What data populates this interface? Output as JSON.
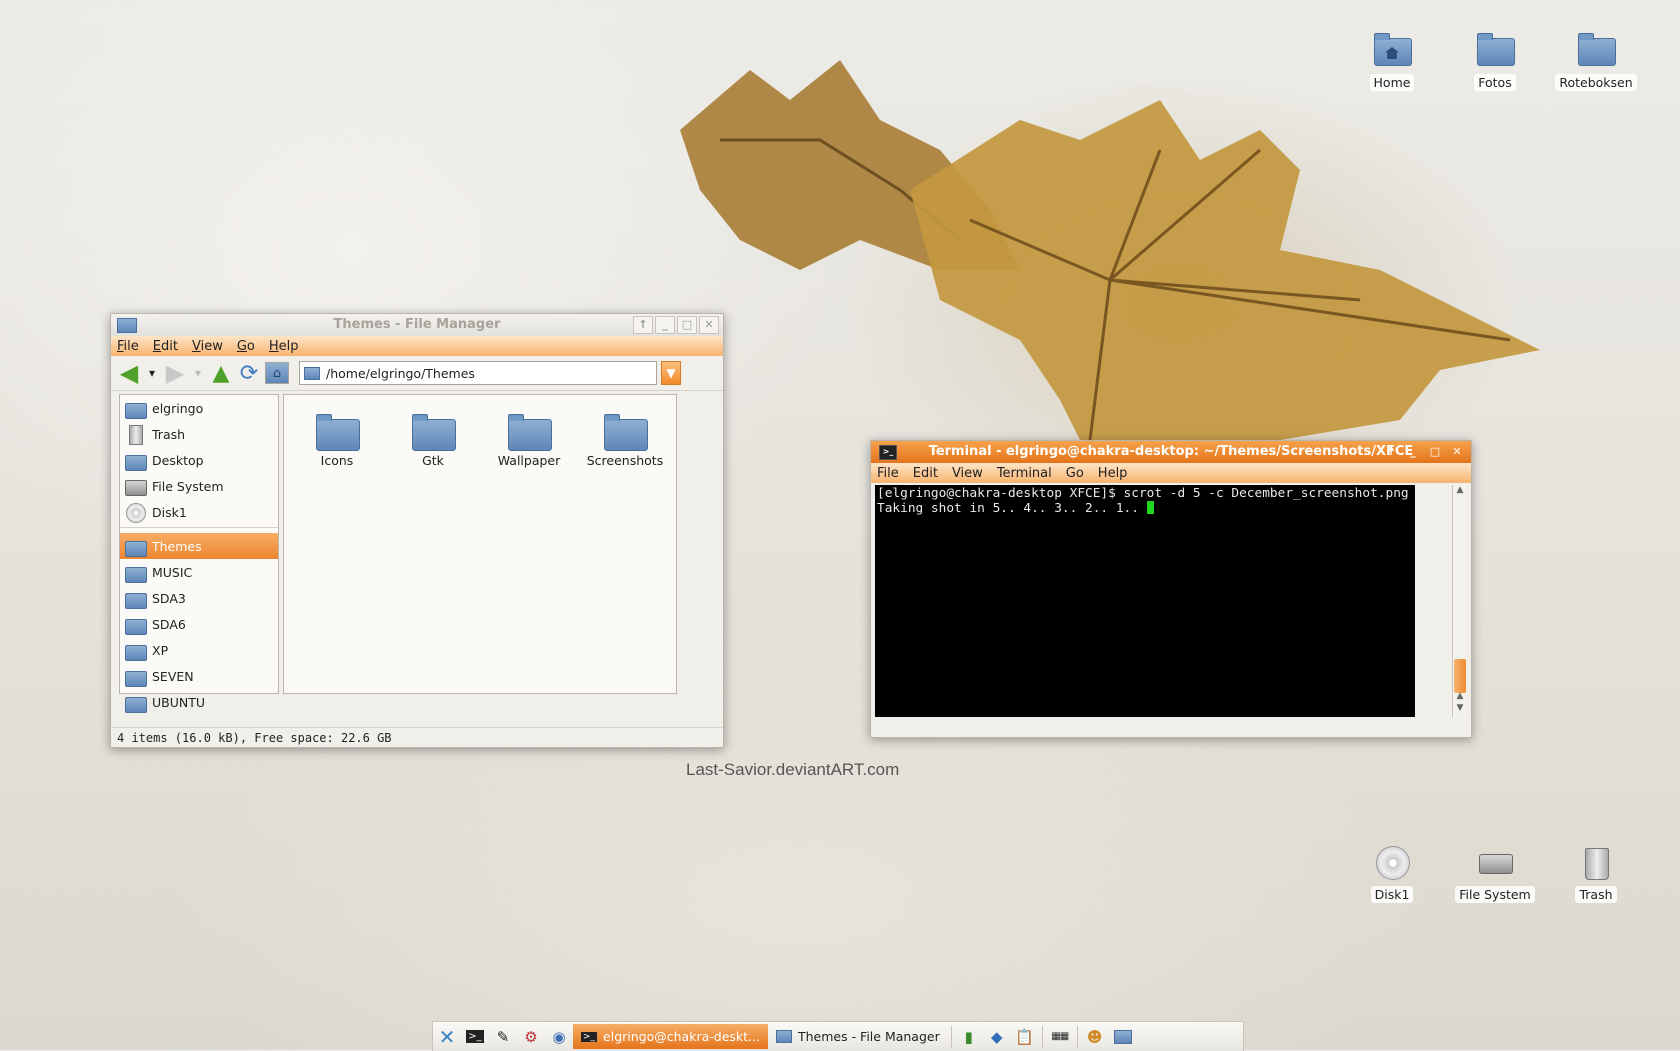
{
  "desktop": {
    "top_icons": [
      {
        "label": "Home",
        "icon": "home-folder-icon"
      },
      {
        "label": "Fotos",
        "icon": "folder-icon"
      },
      {
        "label": "Roteboksen",
        "icon": "folder-icon"
      }
    ],
    "bottom_icons": [
      {
        "label": "Disk1",
        "icon": "disc-icon"
      },
      {
        "label": "File System",
        "icon": "harddisk-icon"
      },
      {
        "label": "Trash",
        "icon": "trash-icon"
      }
    ],
    "watermark": "Last-Savior.deviantART.com"
  },
  "file_manager": {
    "title": "Themes - File Manager",
    "menu": [
      "File",
      "Edit",
      "View",
      "Go",
      "Help"
    ],
    "path": "/home/elgringo/Themes",
    "places": [
      {
        "label": "elgringo",
        "icon": "home-icon"
      },
      {
        "label": "Trash",
        "icon": "trash-icon"
      },
      {
        "label": "Desktop",
        "icon": "desktop-icon"
      },
      {
        "label": "File System",
        "icon": "harddisk-icon"
      },
      {
        "label": "Disk1",
        "icon": "disc-icon"
      }
    ],
    "bookmarks": [
      {
        "label": "Themes",
        "selected": true
      },
      {
        "label": "MUSIC"
      },
      {
        "label": "SDA3"
      },
      {
        "label": "SDA6"
      },
      {
        "label": "XP"
      },
      {
        "label": "SEVEN"
      },
      {
        "label": "UBUNTU"
      }
    ],
    "items": [
      "Icons",
      "Gtk",
      "Wallpaper",
      "Screenshots"
    ],
    "status": "4 items (16.0 kB), Free space: 22.6 GB"
  },
  "terminal": {
    "title": "Terminal - elgringo@chakra-desktop: ~/Themes/Screenshots/XFCE",
    "menu": [
      "File",
      "Edit",
      "View",
      "Terminal",
      "Go",
      "Help"
    ],
    "line1": "[elgringo@chakra-desktop XFCE]$ scrot -d 5 -c December_screenshot.png",
    "line2": "Taking shot in 5.. 4.. 3.. 2.. 1.. "
  },
  "taskbar": {
    "tasks": [
      {
        "label": "elgringo@chakra-deskt...",
        "active": true
      },
      {
        "label": "Themes - File Manager",
        "active": false
      }
    ]
  },
  "colors": {
    "accent": "#ec8630",
    "folder": "#6f94c2",
    "terminal_bg": "#000000",
    "cursor": "#21d621"
  }
}
